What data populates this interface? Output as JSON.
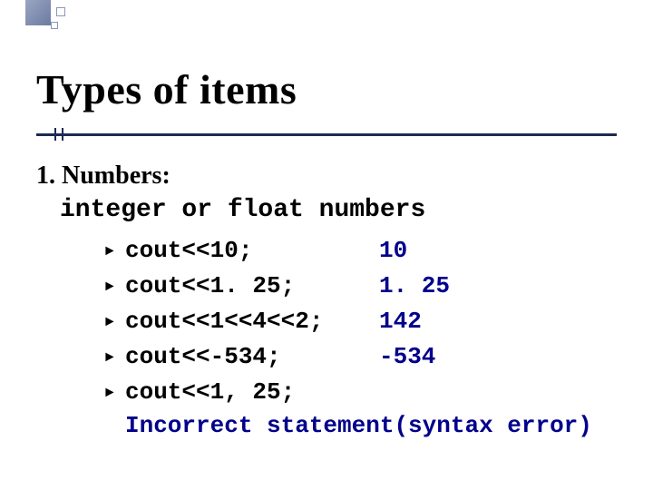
{
  "title": "Types of items",
  "section": {
    "number": "1.",
    "heading": "Numbers:",
    "subtitle": "integer or float numbers"
  },
  "items": [
    {
      "code": "cout<<10;",
      "output": "10"
    },
    {
      "code": "cout<<1. 25;",
      "output": "1. 25"
    },
    {
      "code": "cout<<1<<4<<2;",
      "output": "142"
    },
    {
      "code": "cout<<-534;",
      "output": "-534"
    },
    {
      "code": "cout<<1, 25;",
      "output": ""
    }
  ],
  "error_line": "Incorrect statement(syntax error)"
}
